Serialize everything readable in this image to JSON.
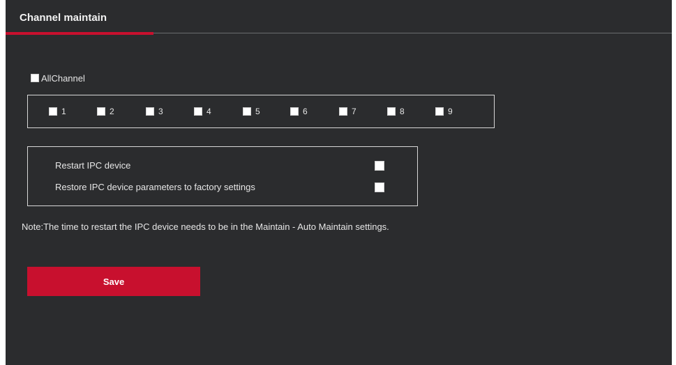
{
  "header": {
    "title": "Channel maintain"
  },
  "all_channel": {
    "label": "AllChannel",
    "checked": false
  },
  "channels": [
    {
      "label": "1",
      "checked": false
    },
    {
      "label": "2",
      "checked": false
    },
    {
      "label": "3",
      "checked": false
    },
    {
      "label": "4",
      "checked": false
    },
    {
      "label": "5",
      "checked": false
    },
    {
      "label": "6",
      "checked": false
    },
    {
      "label": "7",
      "checked": false
    },
    {
      "label": "8",
      "checked": false
    },
    {
      "label": "9",
      "checked": false
    }
  ],
  "ipc_options": {
    "restart_label": "Restart IPC device",
    "restart_checked": false,
    "restore_label": "Restore IPC device parameters to factory settings",
    "restore_checked": false
  },
  "note": "Note:The time to restart the IPC device needs to be in the Maintain - Auto Maintain settings.",
  "actions": {
    "save_label": "Save"
  },
  "colors": {
    "panel_bg": "#2b2c2e",
    "accent": "#c8102e",
    "text": "#e6e6e6"
  }
}
